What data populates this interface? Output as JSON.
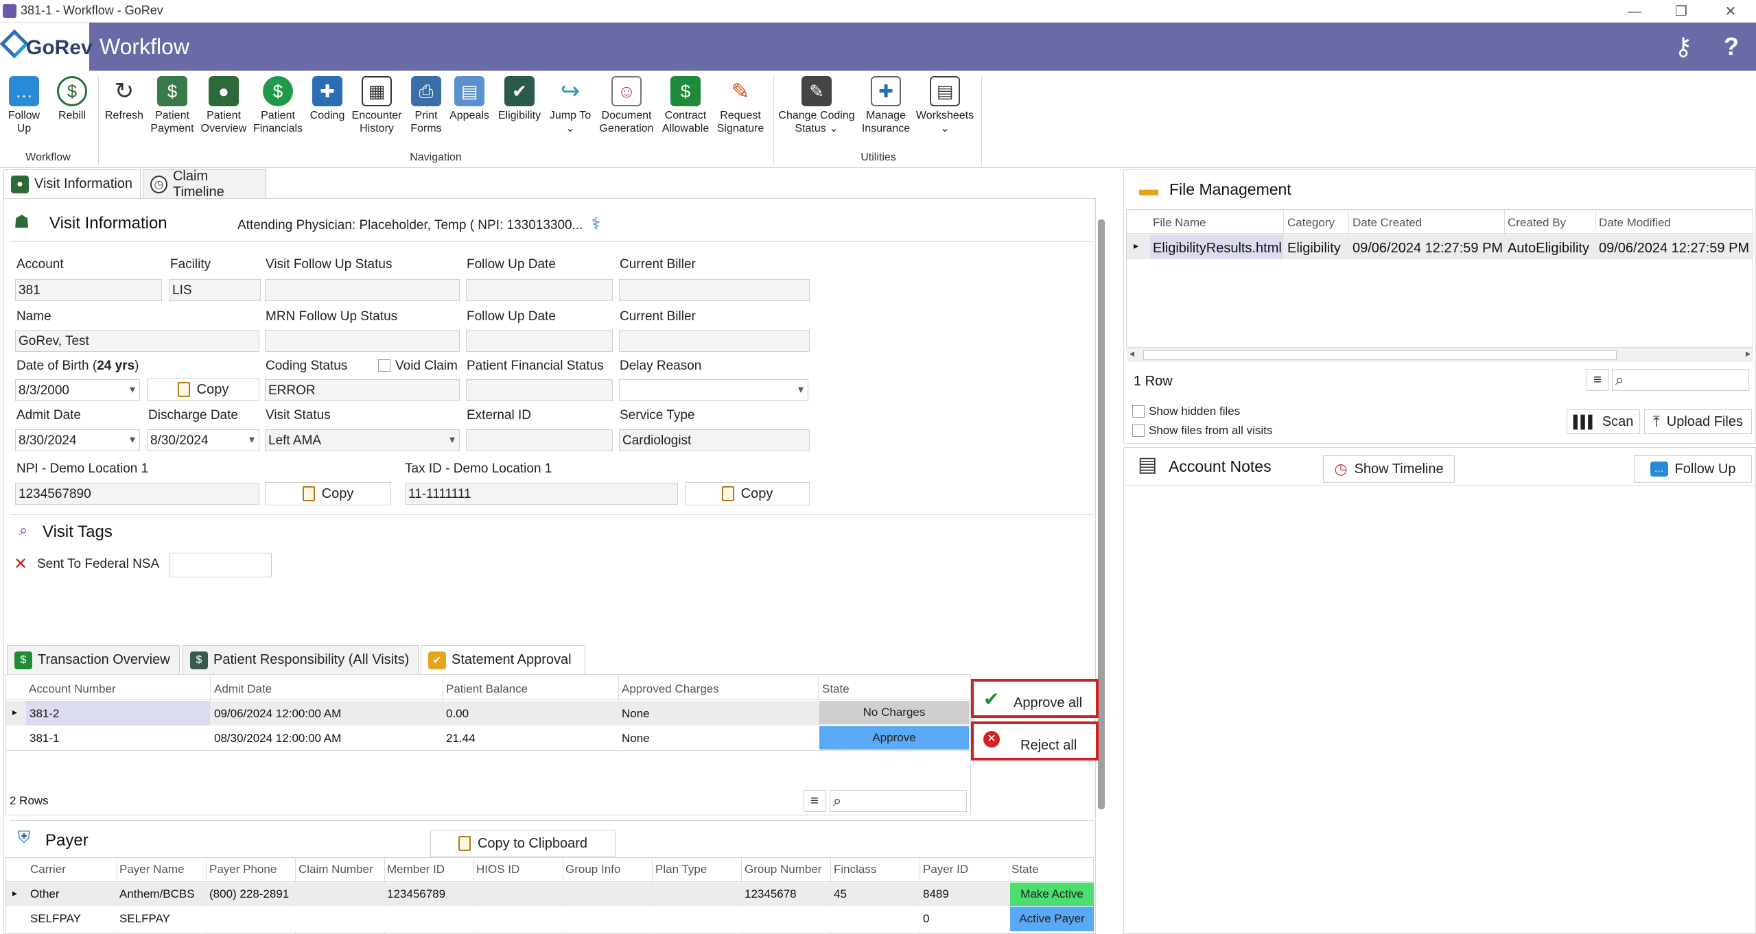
{
  "window": {
    "title": "381-1 - Workflow - GoRev"
  },
  "header": {
    "logo": "GoRev",
    "title": "Workflow",
    "help": "?"
  },
  "ribbon": {
    "buttons": [
      {
        "label1": "Follow",
        "label2": "Up"
      },
      {
        "label1": "Rebill",
        "label2": ""
      },
      {
        "label1": "Refresh",
        "label2": ""
      },
      {
        "label1": "Patient",
        "label2": "Payment"
      },
      {
        "label1": "Patient",
        "label2": "Overview"
      },
      {
        "label1": "Patient",
        "label2": "Financials"
      },
      {
        "label1": "Coding",
        "label2": ""
      },
      {
        "label1": "Encounter",
        "label2": "History"
      },
      {
        "label1": "Print",
        "label2": "Forms"
      },
      {
        "label1": "Appeals",
        "label2": ""
      },
      {
        "label1": "Eligibility",
        "label2": ""
      },
      {
        "label1": "Jump To",
        "label2": ""
      },
      {
        "label1": "Document",
        "label2": "Generation"
      },
      {
        "label1": "Contract",
        "label2": "Allowable"
      },
      {
        "label1": "Request",
        "label2": "Signature"
      },
      {
        "label1": "Change Coding",
        "label2": "Status"
      },
      {
        "label1": "Manage",
        "label2": "Insurance"
      },
      {
        "label1": "Worksheets",
        "label2": ""
      }
    ],
    "groups": {
      "workflow": "Workflow",
      "navigation": "Navigation",
      "utilities": "Utilities"
    }
  },
  "tabs": {
    "visit_info": "Visit Information",
    "claim_timeline": "Claim Timeline"
  },
  "visit": {
    "heading": "Visit Information",
    "attending": "Attending Physician: Placeholder, Temp ( NPI: 133013300...",
    "labels": {
      "account": "Account",
      "facility": "Facility",
      "visit_fu_status": "Visit Follow Up Status",
      "fu_date": "Follow Up Date",
      "current_biller": "Current Biller",
      "name": "Name",
      "mrn_fu_status": "MRN Follow Up Status",
      "dob_prefix": "Date of Birth (",
      "dob_age": "24 yrs",
      "dob_suffix": ")",
      "coding_status": "Coding Status",
      "void_claim": "Void Claim",
      "pfs": "Patient Financial Status",
      "delay_reason": "Delay Reason",
      "admit_date": "Admit Date",
      "discharge_date": "Discharge Date",
      "visit_status": "Visit Status",
      "external_id": "External ID",
      "service_type": "Service Type",
      "npi": "NPI - Demo Location 1",
      "tax_id": "Tax ID - Demo Location 1"
    },
    "values": {
      "account": "381",
      "facility": "LIS",
      "name": "GoRev, Test",
      "dob": "8/3/2000",
      "coding_status": "ERROR",
      "admit_date": "8/30/2024",
      "discharge_date": "8/30/2024",
      "visit_status": "Left AMA",
      "service_type": "Cardiologist",
      "npi": "1234567890",
      "tax_id": "11-1111111"
    },
    "copy": "Copy"
  },
  "tags": {
    "heading": "Visit Tags",
    "item": "Sent To Federal NSA"
  },
  "subtabs": {
    "transaction": "Transaction Overview",
    "patient_resp": "Patient Responsibility (All Visits)",
    "statement": "Statement Approval"
  },
  "statement_grid": {
    "headers": [
      "Account Number",
      "Admit Date",
      "Patient Balance",
      "Approved Charges",
      "State"
    ],
    "rows": [
      [
        "381-2",
        "09/06/2024 12:00:00 AM",
        "0.00",
        "None",
        "No Charges"
      ],
      [
        "381-1",
        "08/30/2024 12:00:00 AM",
        "21.44",
        "None",
        "Approve"
      ]
    ],
    "count": "2 Rows",
    "approve_all": "Approve all",
    "reject_all": "Reject all"
  },
  "payer": {
    "heading": "Payer",
    "copy_clip": "Copy to Clipboard",
    "headers": [
      "Carrier",
      "Payer Name",
      "Payer Phone",
      "Claim Number",
      "Member ID",
      "HIOS ID",
      "Group Info",
      "Plan Type",
      "Group Number",
      "Finclass",
      "Payer ID",
      "State"
    ],
    "rows": [
      [
        "Other",
        "Anthem/BCBS",
        "(800) 228-2891",
        "",
        "123456789",
        "",
        "",
        "",
        "12345678",
        "45",
        "8489",
        "Make Active"
      ],
      [
        "SELFPAY",
        "SELFPAY",
        "",
        "",
        "",
        "",
        "",
        "",
        "",
        "",
        "0",
        "Active Payer"
      ]
    ]
  },
  "files": {
    "heading": "File Management",
    "headers": [
      "File Name",
      "Category",
      "Date Created",
      "Created By",
      "Date Modified"
    ],
    "row": [
      "EligibilityResults.html",
      "Eligibility",
      "09/06/2024 12:27:59 PM",
      "AutoEligibility",
      "09/06/2024 12:27:59 PM"
    ],
    "count": "1 Row",
    "show_hidden": "Show hidden files",
    "show_all": "Show files from all visits",
    "scan": "Scan",
    "upload": "Upload Files"
  },
  "notes": {
    "heading": "Account Notes",
    "timeline": "Show Timeline",
    "follow_up": "Follow Up"
  },
  "colors": {
    "header": "#6a6aa6",
    "approve": "#5aa9f5",
    "make_active": "#4cde6e",
    "active_payer": "#5aa9f5",
    "highlight": "#d32020"
  }
}
